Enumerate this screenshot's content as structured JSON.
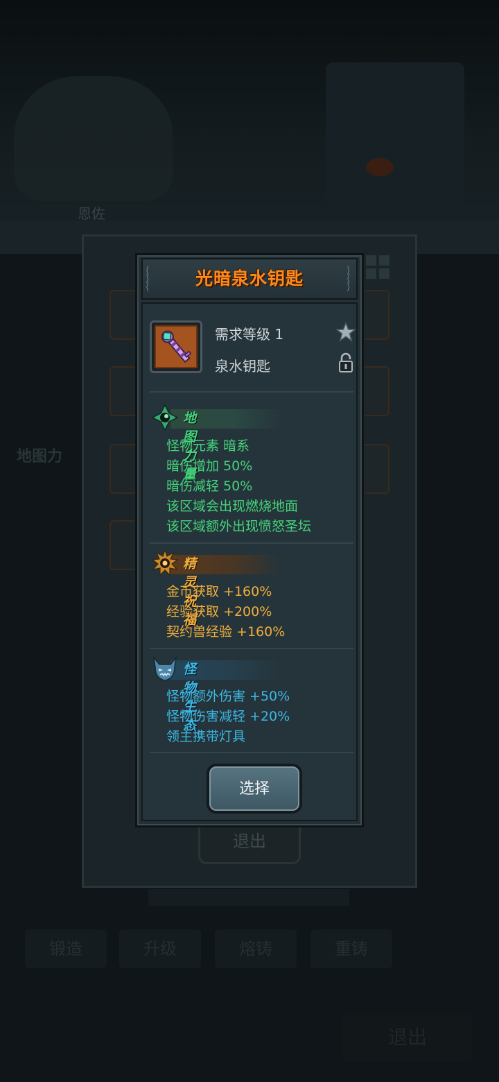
{
  "background": {
    "npc_name": "恩佐",
    "map_label": "地图力",
    "exit_label": "退出",
    "tabs": [
      "锻造",
      "升级",
      "熔铸",
      "重铸"
    ],
    "bottom_exit_label": "退出"
  },
  "dialog": {
    "title": "光暗泉水钥匙",
    "item": {
      "icon": "fountain-key-icon",
      "required_level": "需求等级 1",
      "name": "泉水钥匙",
      "favorite_icon": "star-icon",
      "lock_icon": "padlock-open-icon"
    },
    "sections": [
      {
        "title": "地图力量",
        "icon": "map-power-icon",
        "color": "#45d37c",
        "lines": [
          "怪物元素 暗系",
          "暗伤增加 50%",
          "暗伤减轻 50%",
          "该区域会出现燃烧地面",
          "该区域额外出现愤怒圣坛"
        ]
      },
      {
        "title": "精灵祝福",
        "icon": "spirit-blessing-icon",
        "color": "#f2ad3a",
        "lines": [
          "金币获取 +160%",
          "经验获取 +200%",
          "契约兽经验 +160%"
        ]
      },
      {
        "title": "怪物生态",
        "icon": "demon-head-icon",
        "color": "#3cb8e6",
        "lines": [
          "怪物额外伤害 +50%",
          "怪物伤害减轻 +20%",
          "领主携带灯具"
        ]
      }
    ],
    "select_label": "选择"
  }
}
